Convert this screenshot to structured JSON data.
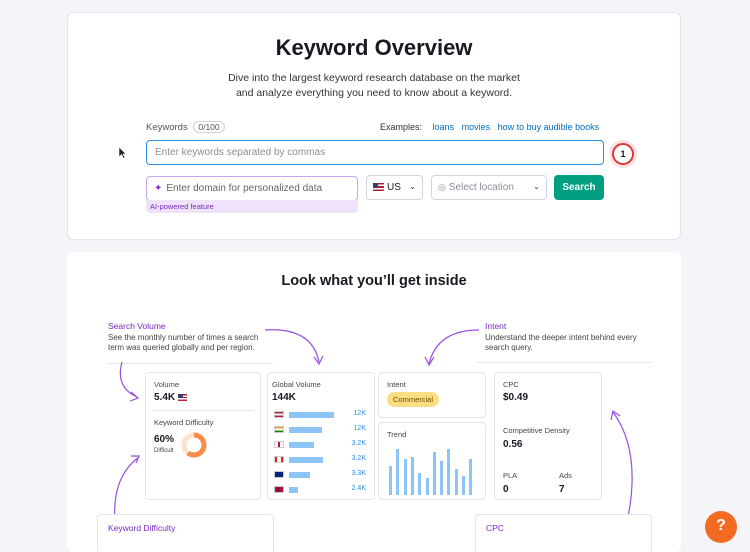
{
  "hero": {
    "title": "Keyword Overview",
    "subtitle_line1": "Dive into the largest keyword research database on the market",
    "subtitle_line2": "and analyze everything you need to know about a keyword.",
    "keywords_label": "Keywords",
    "keywords_count": "0/100",
    "examples_label": "Examples:",
    "example_1": "loans",
    "example_2": "movies",
    "example_3": "how to buy audible books",
    "keyword_placeholder": "Enter keywords separated by commas",
    "step_badge": "1",
    "domain_placeholder": "Enter domain for personalized data",
    "ai_note": "AI-powered feature",
    "country": "US",
    "location_placeholder": "Select location",
    "search_label": "Search"
  },
  "preview": {
    "heading": "Look what you’ll get inside",
    "anno_search_volume_title": "Search Volume",
    "anno_search_volume_line1": "See the monthly number of times a search",
    "anno_search_volume_line2": "term was queried globally and per region.",
    "anno_intent_title": "Intent",
    "anno_intent_line1": "Understand the deeper intent behind every",
    "anno_intent_line2": "search query.",
    "anno_kd_title": "Keyword Difficulty",
    "anno_cpc_title": "CPC",
    "volume_label": "Volume",
    "volume_value": "5.4K",
    "kd_label": "Keyword Difficulty",
    "kd_value": "60%",
    "kd_level": "Difficult",
    "kd_percent": 60,
    "global_volume_label": "Global Volume",
    "global_volume_value": "144K",
    "global_rows": [
      {
        "flag": "us-flag",
        "value": "12K",
        "fill": 0.82
      },
      {
        "flag": "in-flag",
        "value": "12K",
        "fill": 0.6
      },
      {
        "flag": "uk-flag",
        "value": "3.2K",
        "fill": 0.45
      },
      {
        "flag": "ca-flag",
        "value": "3.2K",
        "fill": 0.62
      },
      {
        "flag": "au-flag",
        "value": "3.3K",
        "fill": 0.38
      },
      {
        "flag": "no-flag",
        "value": "2.4K",
        "fill": 0.16
      }
    ],
    "intent_label": "Intent",
    "intent_value": "Commercial",
    "trend_label": "Trend",
    "trend_levels": [
      0.6,
      0.95,
      0.75,
      0.8,
      0.45,
      0.35,
      0.9,
      0.7,
      0.95,
      0.55,
      0.4,
      0.75
    ],
    "cpc_label": "CPC",
    "cpc_value": "$0.49",
    "comp_density_label": "Competitive Density",
    "comp_density_value": "0.56",
    "pla_label": "PLA",
    "pla_value": "0",
    "ads_label": "Ads",
    "ads_value": "7"
  },
  "help_label": "?",
  "colors": {
    "accent": "#009f81",
    "ai_purple": "#7a2ac3",
    "bar_blue": "#8cc5f5",
    "help_orange": "#f36a22"
  }
}
